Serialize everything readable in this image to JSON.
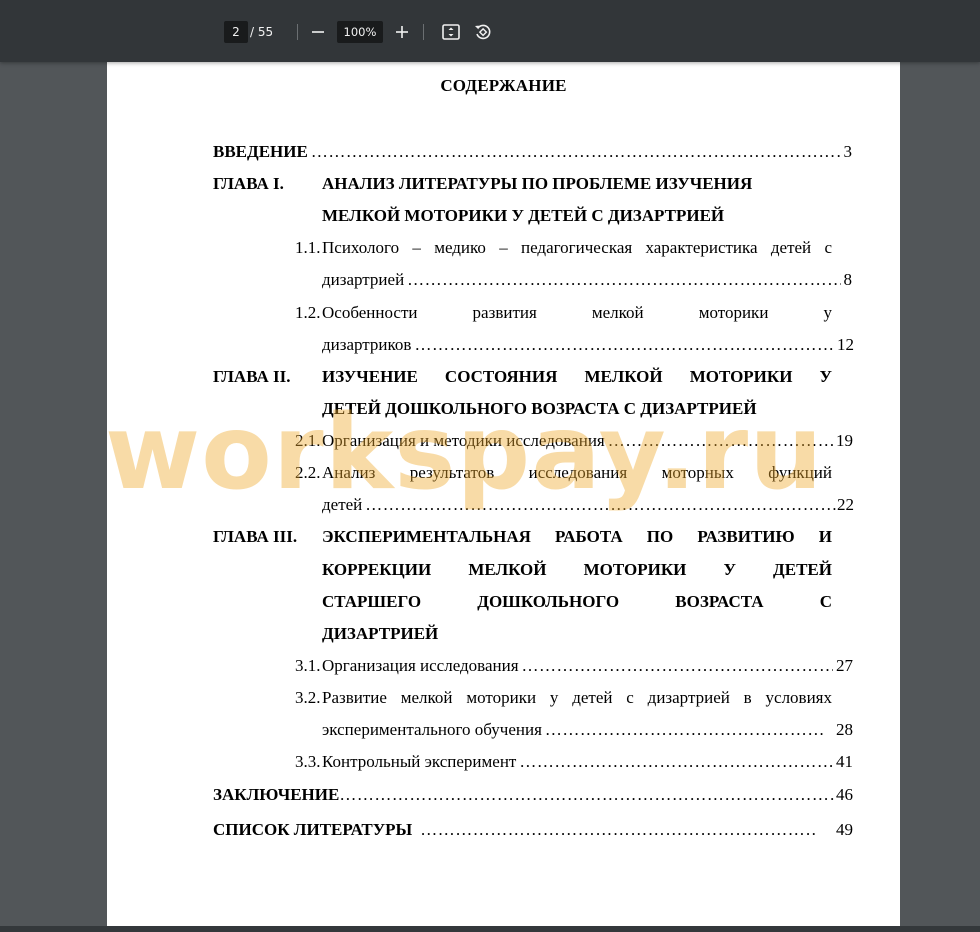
{
  "toolbar": {
    "current_page": "2",
    "total_pages": "/ 55",
    "zoom": "100%",
    "icons": [
      "minus-icon",
      "plus-icon",
      "fit-page-icon",
      "rotate-icon"
    ]
  },
  "document": {
    "title": "СОДЕРЖАНИЕ",
    "watermark": "workspay.ru",
    "intro": {
      "label": "ВВЕДЕНИЕ",
      "page": "3"
    },
    "ch1": {
      "num": "ГЛАВА I.",
      "title_line1": "АНАЛИЗ ЛИТЕРАТУРЫ ПО ПРОБЛЕМЕ ИЗУЧЕНИЯ",
      "title_line2": "МЕЛКОЙ МОТОРИКИ У ДЕТЕЙ С ДИЗАРТРИЕЙ",
      "s1_num": "1.1.",
      "s1_line1": "Психолого – медико – педагогическая характеристика детей с",
      "s1_line2": "дизартрией",
      "s1_page": "8",
      "s2_num": "1.2.",
      "s2_line1": "Особенности развития мелкой моторики у",
      "s2_line2": "дизартриков",
      "s2_page": "12"
    },
    "ch2": {
      "num": "ГЛАВА II.",
      "title_line1": "ИЗУЧЕНИЕ СОСТОЯНИЯ МЕЛКОЙ МОТОРИКИ У",
      "title_line2": "ДЕТЕЙ ДОШКОЛЬНОГО ВОЗРАСТА С ДИЗАРТРИЕЙ",
      "s1_num": "2.1.",
      "s1_text": "Организация и методики исследования",
      "s1_page": "19",
      "s2_num": "2.2.",
      "s2_line1": "Анализ результатов исследования моторных функций",
      "s2_line2": "детей",
      "s2_page": "22"
    },
    "ch3": {
      "num": "ГЛАВА III.",
      "title_line1": "ЭКСПЕРИМЕНТАЛЬНАЯ РАБОТА ПО РАЗВИТИЮ И",
      "title_line2": "КОРРЕКЦИИ МЕЛКОЙ МОТОРИКИ У ДЕТЕЙ",
      "title_line3": "СТАРШЕГО ДОШКОЛЬНОГО ВОЗРАСТА С",
      "title_line4": "ДИЗАРТРИЕЙ",
      "s1_num": "3.1.",
      "s1_text": "Организация исследования",
      "s1_page": "27",
      "s2_num": "3.2.",
      "s2_line1": "Развитие мелкой моторики у детей с дизартрией в условиях",
      "s2_line2": "экспериментального обучения",
      "s2_page": "28",
      "s3_num": "3.3.",
      "s3_text": "Контрольный эксперимент",
      "s3_page": "41"
    },
    "conclusion": {
      "label": "ЗАКЛЮЧЕНИЕ",
      "page": "46"
    },
    "references": {
      "label": "СПИСОК ЛИТЕРАТУРЫ",
      "page": "49"
    }
  }
}
